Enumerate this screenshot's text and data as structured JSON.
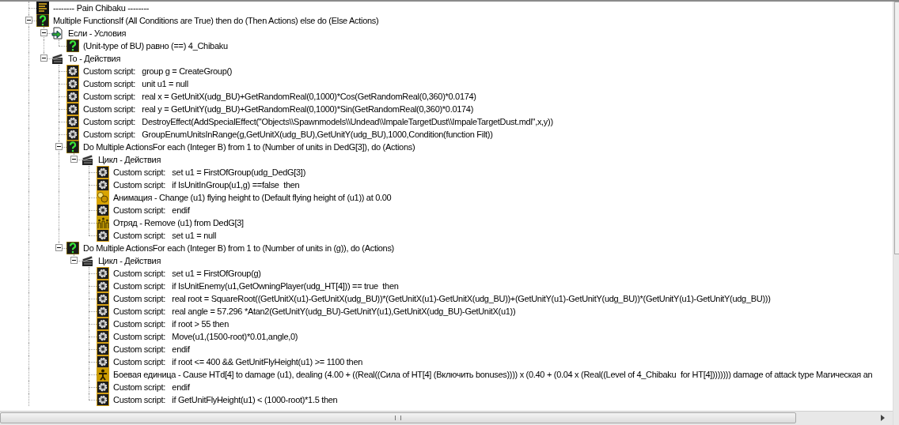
{
  "tree": [
    {
      "kind": "comment",
      "text": "-------- Pain Chibaku --------"
    },
    {
      "kind": "multiple",
      "text": "Multiple FunctionsIf (All Conditions are True) then do (Then Actions) else do (Else Actions)",
      "expanded": true,
      "children": [
        {
          "kind": "conditions",
          "text": "Если - Условия",
          "expanded": true,
          "children": [
            {
              "kind": "multiple",
              "text": "(Unit-type of BU) равно (==) 4_Chibaku"
            }
          ]
        },
        {
          "kind": "actions",
          "text": "То - Действия",
          "expanded": true,
          "children": [
            {
              "kind": "script",
              "text": "Custom script:   group g = CreateGroup()"
            },
            {
              "kind": "script",
              "text": "Custom script:   unit u1 = null"
            },
            {
              "kind": "script",
              "text": "Custom script:   real x = GetUnitX(udg_BU)+GetRandomReal(0,1000)*Cos(GetRandomReal(0,360)*0.0174)"
            },
            {
              "kind": "script",
              "text": "Custom script:   real y = GetUnitY(udg_BU)+GetRandomReal(0,1000)*Sin(GetRandomReal(0,360)*0.0174)"
            },
            {
              "kind": "script",
              "text": "Custom script:   DestroyEffect(AddSpecialEffect(\"Objects\\\\Spawnmodels\\\\Undead\\\\ImpaleTargetDust\\\\ImpaleTargetDust.mdl\",x,y))"
            },
            {
              "kind": "script",
              "text": "Custom script:   GroupEnumUnitsInRange(g,GetUnitX(udg_BU),GetUnitY(udg_BU),1000,Condition(function Filt))"
            },
            {
              "kind": "multiple",
              "text": "Do Multiple ActionsFor each (Integer B) from 1 to (Number of units in DedG[3]), do (Actions)",
              "expanded": true,
              "children": [
                {
                  "kind": "actions",
                  "text": "Цикл - Действия",
                  "expanded": true,
                  "children": [
                    {
                      "kind": "script",
                      "text": "Custom script:   set u1 = FirstOfGroup(udg_DedG[3])"
                    },
                    {
                      "kind": "script",
                      "text": "Custom script:   if IsUnitInGroup(u1,g) ==false  then"
                    },
                    {
                      "kind": "animation",
                      "text": "Анимация - Change (u1) flying height to (Default flying height of (u1)) at 0.00"
                    },
                    {
                      "kind": "script",
                      "text": "Custom script:   endif"
                    },
                    {
                      "kind": "group",
                      "text": "Отряд - Remove (u1) from DedG[3]"
                    },
                    {
                      "kind": "script",
                      "text": "Custom script:   set u1 = null"
                    }
                  ]
                }
              ]
            },
            {
              "kind": "multiple",
              "text": "Do Multiple ActionsFor each (Integer B) from 1 to (Number of units in (g)), do (Actions)",
              "expanded": true,
              "children": [
                {
                  "kind": "actions",
                  "text": "Цикл - Действия",
                  "expanded": true,
                  "children": [
                    {
                      "kind": "script",
                      "text": "Custom script:   set u1 = FirstOfGroup(g)"
                    },
                    {
                      "kind": "script",
                      "text": "Custom script:   if IsUnitEnemy(u1,GetOwningPlayer(udg_HT[4])) == true  then"
                    },
                    {
                      "kind": "script",
                      "text": "Custom script:   real root = SquareRoot((GetUnitX(u1)-GetUnitX(udg_BU))*(GetUnitX(u1)-GetUnitX(udg_BU))+(GetUnitY(u1)-GetUnitY(udg_BU))*(GetUnitY(u1)-GetUnitY(udg_BU)))"
                    },
                    {
                      "kind": "script",
                      "text": "Custom script:   real angle = 57.296 *Atan2(GetUnitY(udg_BU)-GetUnitY(u1),GetUnitX(udg_BU)-GetUnitX(u1))"
                    },
                    {
                      "kind": "script",
                      "text": "Custom script:   if root > 55 then"
                    },
                    {
                      "kind": "script",
                      "text": "Custom script:   Move(u1,(1500-root)*0.01,angle,0)"
                    },
                    {
                      "kind": "script",
                      "text": "Custom script:   endif"
                    },
                    {
                      "kind": "script",
                      "text": "Custom script:   if root <= 400 && GetUnitFlyHeight(u1) >= 1100 then"
                    },
                    {
                      "kind": "unit",
                      "text": "Боевая единица - Cause HTd[4] to damage (u1), dealing (4.00 + ((Real((Сила of HT[4] (Включить bonuses)))) x (0.40 + (0.04 x (Real((Level of 4_Chibaku  for HT[4]))))))) damage of attack type Магическая an"
                    },
                    {
                      "kind": "script",
                      "text": "Custom script:   endif"
                    },
                    {
                      "kind": "script",
                      "text": "Custom script:   if GetUnitFlyHeight(u1) < (1000-root)*1.5 then"
                    }
                  ]
                }
              ]
            }
          ]
        }
      ]
    }
  ]
}
